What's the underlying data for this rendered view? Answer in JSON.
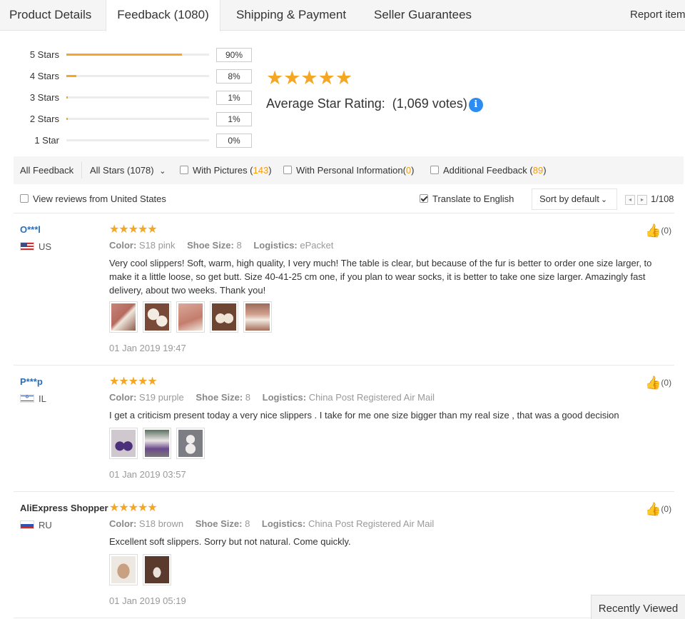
{
  "tabs": {
    "product_details": "Product Details",
    "feedback": "Feedback (1080)",
    "shipping": "Shipping & Payment",
    "seller": "Seller Guarantees",
    "report": "Report item"
  },
  "rating": {
    "histogram": [
      {
        "label": "5 Stars",
        "pct_text": "90%",
        "fill": 0.9
      },
      {
        "label": "4 Stars",
        "pct_text": "8%",
        "fill": 0.08
      },
      {
        "label": "3 Stars",
        "pct_text": "1%",
        "fill": 0.01
      },
      {
        "label": "2 Stars",
        "pct_text": "1%",
        "fill": 0.01
      },
      {
        "label": "1 Star",
        "pct_text": "0%",
        "fill": 0.0
      }
    ],
    "stars": "★★★★★",
    "average_label": "Average Star Rating:",
    "votes": "(1,069 votes)",
    "info_glyph": "i",
    "star_color": "#f5a623"
  },
  "filters": {
    "all_feedback": "All Feedback",
    "all_stars": "All Stars (1078)",
    "dropdown_glyph": "⌄",
    "with_pictures": "With Pictures (",
    "with_pictures_count": "143",
    "with_personal": "With Personal Information(",
    "with_personal_count": "0",
    "additional": "Additional Feedback (",
    "additional_count": "89",
    "close_paren": ")"
  },
  "options": {
    "view_us": "View reviews from United States",
    "view_us_checked": false,
    "translate": "Translate to English",
    "translate_checked": true,
    "sort": "Sort by default",
    "sort_glyph": "⌄",
    "prev_glyph": "◂",
    "next_glyph": "▸",
    "page": "1/108"
  },
  "reviews": [
    {
      "user": "O***l",
      "country": "US",
      "stars": "★★★★★",
      "color_label": "Color:",
      "color": "S18 pink",
      "size_label": "Shoe Size:",
      "size": "8",
      "logistics_label": "Logistics:",
      "logistics": "ePacket",
      "text": "Very cool slippers! Soft, warm, high quality, I very much! The table is clear, but because of the fur is better to order one size larger, to make it a little loose, so get butt. Size 40-41-25 cm one, if you plan to wear socks, it is better to take one size larger. Amazingly fast delivery, about two weeks. Thank you!",
      "date": "01 Jan 2019 19:47",
      "likes": "(0)"
    },
    {
      "user": "P***p",
      "country": "IL",
      "stars": "★★★★★",
      "color_label": "Color:",
      "color": "S19 purple",
      "size_label": "Shoe Size:",
      "size": "8",
      "logistics_label": "Logistics:",
      "logistics": "China Post Registered Air Mail",
      "text": "I get a criticism present today a very nice slippers . I take for me one size bigger than my real size , that was a good decision",
      "date": "01 Jan 2019 03:57",
      "likes": "(0)"
    },
    {
      "user": "AliExpress Shopper",
      "country": "RU",
      "stars": "★★★★★",
      "color_label": "Color:",
      "color": "S18 brown",
      "size_label": "Shoe Size:",
      "size": "8",
      "logistics_label": "Logistics:",
      "logistics": "China Post Registered Air Mail",
      "text": "Excellent soft slippers. Sorry but not natural. Come quickly.",
      "date": "01 Jan 2019 05:19",
      "likes": "(0)"
    }
  ],
  "like_glyph": "👍",
  "recently_viewed": "Recently Viewed"
}
